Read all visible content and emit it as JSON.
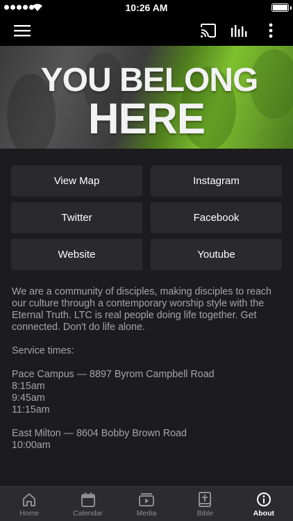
{
  "status_bar": {
    "time": "10:26 AM"
  },
  "toolbar": {
    "menu_icon": "hamburger-icon",
    "cast_icon": "cast-icon",
    "audio_icon": "audio-bars-icon",
    "more_icon": "more-vertical-icon"
  },
  "banner": {
    "line1": "YOU BELONG",
    "line2": "HERE"
  },
  "links": {
    "view_map": "View Map",
    "instagram": "Instagram",
    "twitter": "Twitter",
    "facebook": "Facebook",
    "website": "Website",
    "youtube": "Youtube"
  },
  "about": {
    "description": "We are a community of disciples, making disciples to reach our culture through a contemporary worship style with the Eternal Truth.  LTC is real people doing life together. Get connected. Don't do life alone.",
    "service_heading": "Service times:",
    "campus1": "Pace Campus — 8897 Byrom Campbell Road",
    "campus1_times": [
      "8:15am",
      "9:45am",
      "11:15am"
    ],
    "campus2": "East Milton — 8604 Bobby Brown Road",
    "campus2_times": [
      "10:00am"
    ]
  },
  "tabs": [
    {
      "label": "Home",
      "icon": "home-icon",
      "active": false
    },
    {
      "label": "Calendar",
      "icon": "calendar-icon",
      "active": false
    },
    {
      "label": "Media",
      "icon": "media-play-icon",
      "active": false
    },
    {
      "label": "Bible",
      "icon": "bible-icon",
      "active": false
    },
    {
      "label": "About",
      "icon": "info-icon",
      "active": true
    }
  ],
  "colors": {
    "background": "#1c1c1e",
    "button": "#2a2a2c",
    "accent_green": "#7ec12e",
    "text_muted": "#a5a5aa",
    "tab_inactive": "#8e8e93"
  }
}
